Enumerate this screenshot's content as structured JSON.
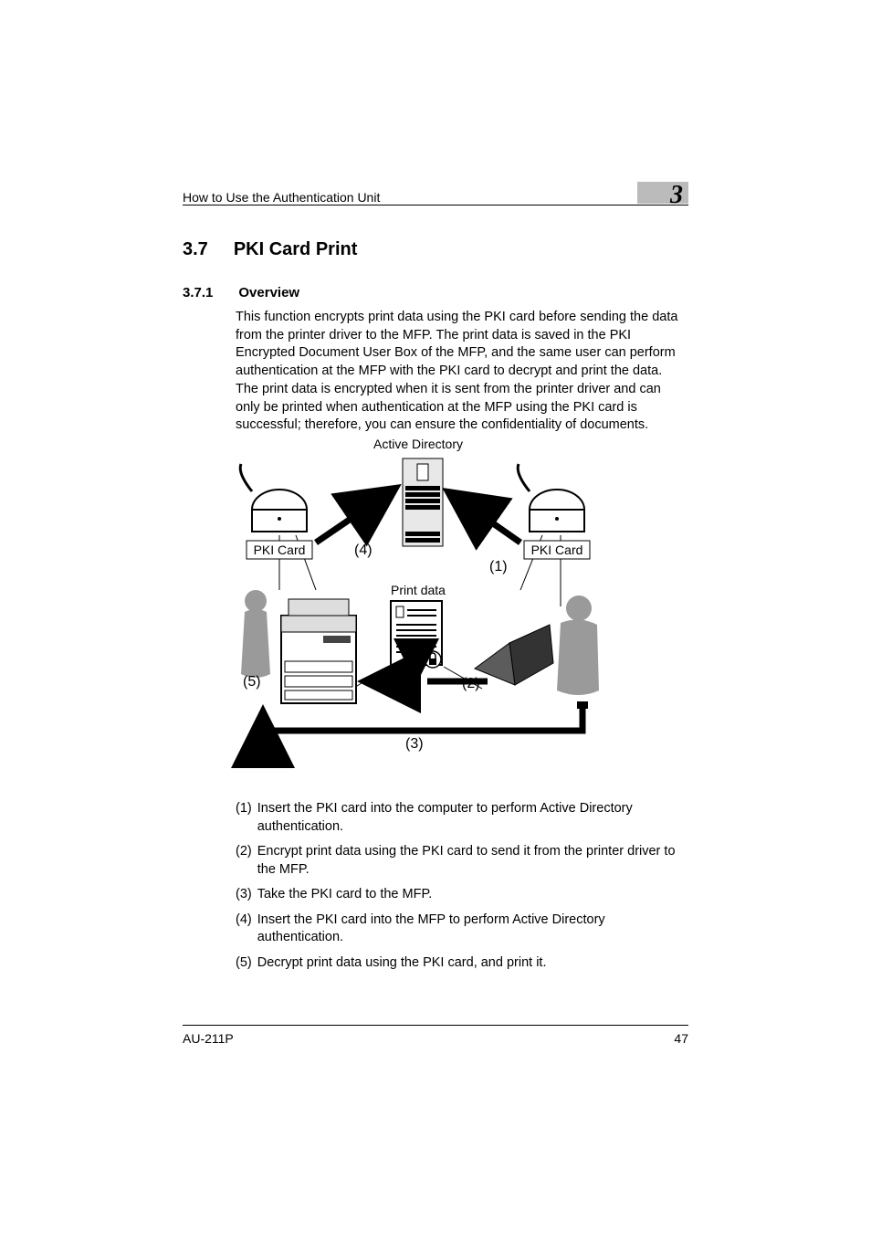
{
  "header": {
    "running_head": "How to Use the Authentication Unit",
    "chapter_number": "3"
  },
  "section": {
    "number": "3.7",
    "title": "PKI Card Print"
  },
  "subsection": {
    "number": "3.7.1",
    "title": "Overview"
  },
  "paragraphs": {
    "p1": "This function encrypts print data using the PKI card before sending the data from the printer driver to the MFP. The print data is saved in the PKI Encrypted Document User Box of the MFP, and the same user can perform authentication at the MFP with the PKI card to decrypt and print the data.",
    "p2": "The print data is encrypted when it is sent from the printer driver and can only be printed when authentication at the MFP using the PKI card is successful; therefore, you can ensure the confidentiality of documents."
  },
  "diagram": {
    "active_directory": "Active Directory",
    "pki_card_left": "PKI Card",
    "pki_card_right": "PKI Card",
    "print_data": "Print data",
    "markers": {
      "m1": "(1)",
      "m2": "(2)",
      "m3": "(3)",
      "m4": "(4)",
      "m5": "(5)"
    }
  },
  "steps": {
    "s1": {
      "n": "(1)",
      "t": "Insert the PKI card into the computer to perform Active Directory authentication."
    },
    "s2": {
      "n": "(2)",
      "t": "Encrypt print data using the PKI card to send it from the printer driver to the MFP."
    },
    "s3": {
      "n": "(3)",
      "t": "Take the PKI card to the MFP."
    },
    "s4": {
      "n": "(4)",
      "t": "Insert the PKI card into the MFP to perform Active Directory authentication."
    },
    "s5": {
      "n": "(5)",
      "t": "Decrypt print data using the PKI card, and print it."
    }
  },
  "footer": {
    "product": "AU-211P",
    "page": "47"
  }
}
